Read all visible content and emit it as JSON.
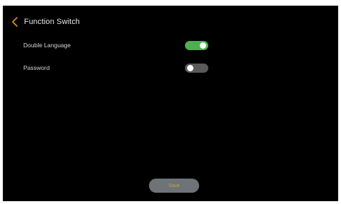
{
  "header": {
    "back_icon": "chevron-left-icon",
    "title": "Function Switch"
  },
  "settings": [
    {
      "label": "Double Language",
      "enabled": true
    },
    {
      "label": "Password",
      "enabled": false
    }
  ],
  "save_button": {
    "label": "Save"
  },
  "colors": {
    "background": "#000000",
    "accent": "#e0902a",
    "toggle_on": "#4caf50",
    "toggle_off": "#5a5a5a",
    "save_button_bg": "#6d7376",
    "save_button_text": "#c8a24a"
  }
}
